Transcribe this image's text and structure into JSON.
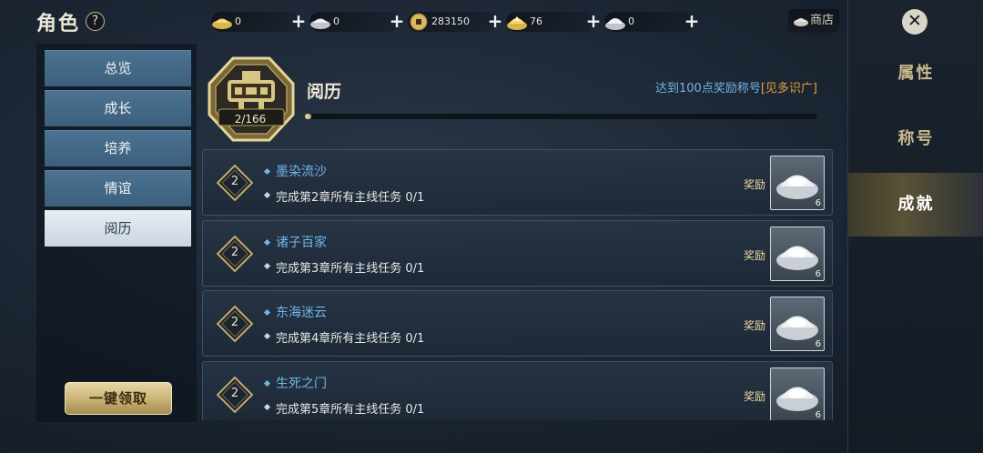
{
  "header": {
    "title": "角色",
    "help_label": "?",
    "shop_label": "商店"
  },
  "currencies": [
    {
      "icon": "gold-ingot-icon",
      "value": "0"
    },
    {
      "icon": "silver-ingot-icon",
      "value": "0"
    },
    {
      "icon": "copper-coin-icon",
      "value": "283150"
    },
    {
      "icon": "gold-ingot-stack-icon",
      "value": "76"
    },
    {
      "icon": "silver-ingot-stack-icon",
      "value": "0"
    }
  ],
  "plus_label": "+",
  "sidebar": {
    "items": [
      {
        "label": "总览"
      },
      {
        "label": "成长"
      },
      {
        "label": "培养"
      },
      {
        "label": "情谊"
      },
      {
        "label": "阅历"
      }
    ],
    "active_index": 4,
    "claim_all_label": "一键领取"
  },
  "section": {
    "title": "阅历",
    "progress_text": "2/166",
    "progress_fraction": 0.012,
    "hint_prefix": "达到100点奖励称号",
    "hint_tag": "[见多识广]"
  },
  "tasks": [
    {
      "level": "2",
      "name": "墨染流沙",
      "desc": "完成第2章所有主线任务 0/1",
      "reward_label": "奖励",
      "reward_qty": "6"
    },
    {
      "level": "2",
      "name": "诸子百家",
      "desc": "完成第3章所有主线任务 0/1",
      "reward_label": "奖励",
      "reward_qty": "6"
    },
    {
      "level": "2",
      "name": "东海迷云",
      "desc": "完成第4章所有主线任务 0/1",
      "reward_label": "奖励",
      "reward_qty": "6"
    },
    {
      "level": "2",
      "name": "生死之门",
      "desc": "完成第5章所有主线任务 0/1",
      "reward_label": "奖励",
      "reward_qty": "6"
    }
  ],
  "right_tabs": {
    "close_label": "✕",
    "items": [
      {
        "label": "属性"
      },
      {
        "label": "称号"
      },
      {
        "label": "成就"
      }
    ],
    "active_index": 2
  },
  "colors": {
    "accent_blue": "#6fb6e6",
    "gold": "#c9b274",
    "hint_orange": "#e0a040"
  }
}
